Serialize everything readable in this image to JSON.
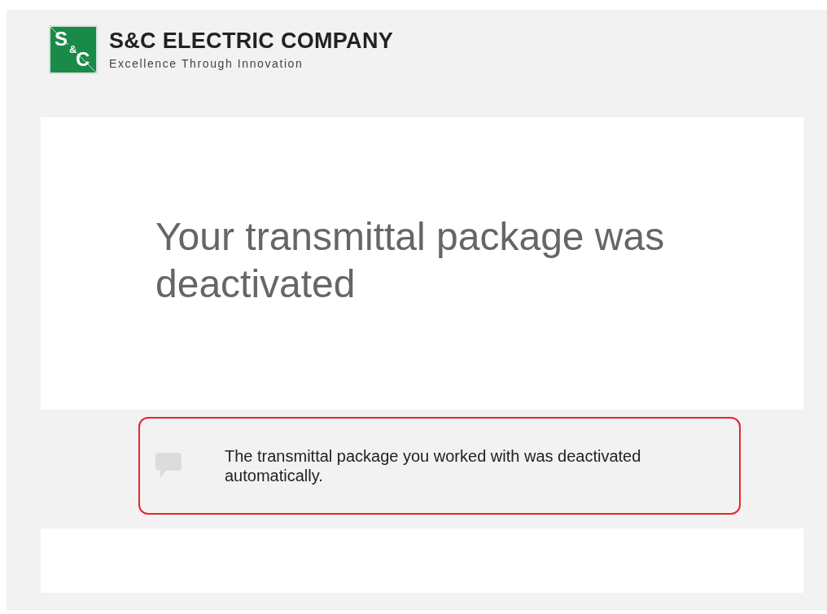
{
  "header": {
    "logo_mark": [
      "S",
      "&",
      "C"
    ],
    "company": "S&C ELECTRIC COMPANY",
    "tagline": "Excellence Through Innovation"
  },
  "message": {
    "heading": "Your transmittal package was deactivated"
  },
  "notice": {
    "highlighted": true,
    "text": "The transmittal package you worked with was deactivated automatically."
  }
}
